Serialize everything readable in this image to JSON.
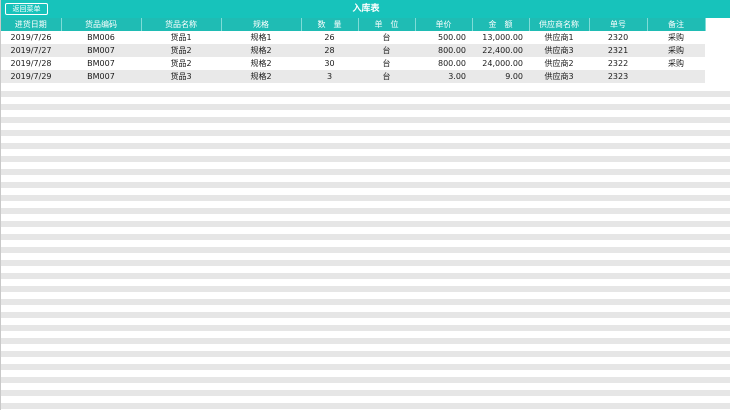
{
  "header": {
    "back_label": "返回菜单",
    "title": "入库表"
  },
  "table": {
    "columns": [
      "进货日期",
      "货品编码",
      "货品名称",
      "规格",
      "数　量",
      "单　位",
      "单价",
      "金　额",
      "供应商名称",
      "单号",
      "备注"
    ],
    "rows": [
      [
        "2019/7/26",
        "BM006",
        "货品1",
        "规格1",
        "26",
        "台",
        "500.00",
        "13,000.00",
        "供应商1",
        "2320",
        "采购"
      ],
      [
        "2019/7/27",
        "BM007",
        "货品2",
        "规格2",
        "28",
        "台",
        "800.00",
        "22,400.00",
        "供应商3",
        "2321",
        "采购"
      ],
      [
        "2019/7/28",
        "BM007",
        "货品2",
        "规格2",
        "30",
        "台",
        "800.00",
        "24,000.00",
        "供应商2",
        "2322",
        "采购"
      ],
      [
        "2019/7/29",
        "BM007",
        "货品3",
        "规格2",
        "3",
        "台",
        "3.00",
        "9.00",
        "供应商3",
        "2323",
        ""
      ]
    ]
  },
  "colors": {
    "header_bg": "#17c3bb",
    "column_header_bg": "#1fbcb4",
    "row_alt_bg": "#e9e9e9"
  }
}
